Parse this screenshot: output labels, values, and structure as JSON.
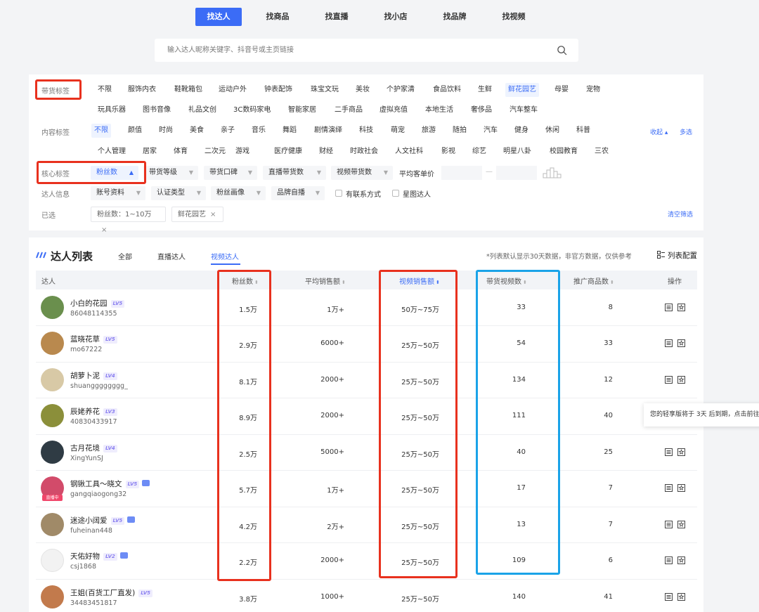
{
  "top_tabs": [
    "找达人",
    "找商品",
    "找直播",
    "找小店",
    "找品牌",
    "找视频"
  ],
  "search": {
    "placeholder": "输入达人昵称关键字、抖音号或主页链接"
  },
  "filters": {
    "goods_label": "带货标签",
    "goods_row1": [
      "不限",
      "服饰内衣",
      "鞋靴箱包",
      "运动户外",
      "钟表配饰",
      "珠宝文玩",
      "美妆",
      "个护家清",
      "食品饮料",
      "生鲜",
      "鲜花园艺",
      "母婴",
      "宠物"
    ],
    "goods_row2": [
      "玩具乐器",
      "图书音像",
      "礼品文创",
      "3C数码家电",
      "智能家居",
      "二手商品",
      "虚拟充值",
      "本地生活",
      "奢侈品",
      "汽车整车"
    ],
    "content_label": "内容标签",
    "content_row1": [
      "不限",
      "颜值",
      "时尚",
      "美食",
      "亲子",
      "音乐",
      "舞蹈",
      "剧情演绎",
      "科技",
      "萌宠",
      "旅游",
      "随拍",
      "汽车",
      "健身",
      "休闲",
      "科普"
    ],
    "content_row2": [
      "个人管理",
      "居家",
      "体育",
      "二次元",
      "游戏",
      "医疗健康",
      "财经",
      "时政社会",
      "人文社科",
      "影视",
      "综艺",
      "明星八卦",
      "校园教育",
      "三农"
    ],
    "collapse": "收起 ▴",
    "multi": "多选",
    "core_label": "核心标签",
    "core_drops": [
      "粉丝数",
      "带货等级",
      "带货口碑",
      "直播带货数",
      "视频带货数"
    ],
    "avg_price": "平均客单价",
    "dash": "—",
    "info_label": "达人信息",
    "info_drops": [
      "账号资料",
      "认证类型",
      "粉丝画像",
      "品牌自播"
    ],
    "check1": "有联系方式",
    "check2": "星图达人",
    "selected_label": "已选",
    "chips": [
      "粉丝数：1~10万",
      "鲜花园艺"
    ],
    "chip_x": "×",
    "clear": "清空筛选"
  },
  "list": {
    "title": "达人列表",
    "tabs": [
      "全部",
      "直播达人",
      "视频达人"
    ],
    "note": "*列表默认显示30天数据，非官方数据，仅供参考",
    "config": "列表配置",
    "columns": [
      "达人",
      "粉丝数",
      "平均销售额",
      "视频销售额",
      "带货视频数",
      "推广商品数",
      "操作"
    ],
    "sort_glyph": "⬍",
    "rows": [
      {
        "name": "小白的花园",
        "lv": "LV5",
        "uid": "86048114355",
        "fans": "1.5万",
        "avg": "1万+",
        "video_sales": "50万~75万",
        "video_count": "33",
        "goods": "8"
      },
      {
        "name": "蓝晓花草",
        "lv": "LV5",
        "uid": "mo67222",
        "fans": "2.9万",
        "avg": "6000+",
        "video_sales": "25万~50万",
        "video_count": "54",
        "goods": "33"
      },
      {
        "name": "胡萝卜泥",
        "lv": "LV4",
        "uid": "shuangggggggg_",
        "fans": "8.1万",
        "avg": "2000+",
        "video_sales": "25万~50万",
        "video_count": "134",
        "goods": "12"
      },
      {
        "name": "辰姥养花",
        "lv": "LV3",
        "uid": "40830433917",
        "fans": "8.9万",
        "avg": "2000+",
        "video_sales": "25万~50万",
        "video_count": "111",
        "goods": "40"
      },
      {
        "name": "古月花境",
        "lv": "LV4",
        "uid": "XingYunSJ",
        "fans": "2.5万",
        "avg": "5000+",
        "video_sales": "25万~50万",
        "video_count": "40",
        "goods": "25"
      },
      {
        "name": "钢锹工具～晓文",
        "lv": "LV5",
        "uid": "gangqiaogong32",
        "fans": "5.7万",
        "avg": "1万+",
        "video_sales": "25万~50万",
        "video_count": "17",
        "goods": "7"
      },
      {
        "name": "迷途小阔爱",
        "lv": "LV5",
        "uid": "fuheinan448",
        "fans": "4.2万",
        "avg": "2万+",
        "video_sales": "25万~50万",
        "video_count": "13",
        "goods": "7"
      },
      {
        "name": "天佑好物",
        "lv": "LV2",
        "uid": "csj1868",
        "fans": "2.2万",
        "avg": "2000+",
        "video_sales": "25万~50万",
        "video_count": "109",
        "goods": "6"
      },
      {
        "name": "王姐(百货工厂直发)",
        "lv": "LV5",
        "uid": "34483451817",
        "fans": "3.8万",
        "avg": "1000+",
        "video_sales": "25万~50万",
        "video_count": "140",
        "goods": "41"
      }
    ],
    "live_badge": "直播中"
  },
  "tooltip": "您的轻享版将于 3天 后到期，点击前往",
  "colors": {
    "accent": "#3b6cf6",
    "highlight_red": "#e8311e",
    "highlight_blue": "#1aa3e8"
  }
}
